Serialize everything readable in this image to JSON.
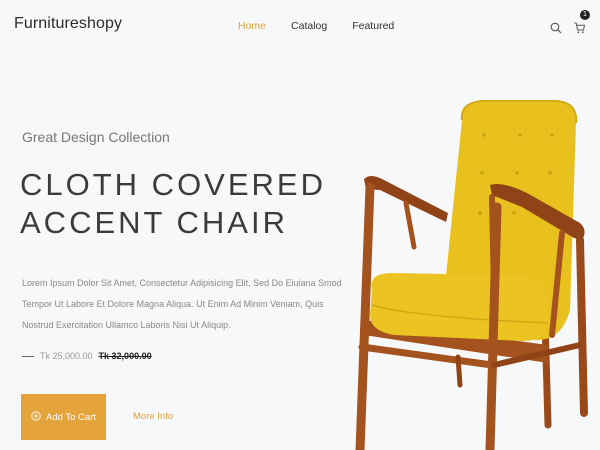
{
  "header": {
    "logo": "Furnitureshopy",
    "nav": [
      {
        "label": "Home",
        "active": true
      },
      {
        "label": "Catalog",
        "active": false
      },
      {
        "label": "Featured",
        "active": false
      }
    ],
    "cart_count": "1",
    "icons": [
      "search-icon",
      "cart-icon"
    ]
  },
  "hero": {
    "subtitle": "Great Design Collection",
    "headline_line1": "CLOTH COVERED",
    "headline_line2": "ACCENT CHAIR",
    "description": "Lorem Ipsum Dolor Sit Amet, Consectetur Adipisicing Elit, Sed Do Eiuiana Smod Tempor Ut Labore Et Dolore Magna Aliqua. Ut Enim Ad Minim Veniam, Quis Nostrud Exercitation Ullamco Laboris Nisi Ut Aliquip.",
    "price_current": "Tk 25,000.00",
    "price_old": "Tk 32,000.00",
    "add_to_cart": "Add To Cart",
    "more_info": "More Info"
  },
  "colors": {
    "accent": "#e5a33b",
    "background": "#f7f8fa",
    "chair_fabric": "#e8c021",
    "chair_wood": "#a4521e"
  }
}
